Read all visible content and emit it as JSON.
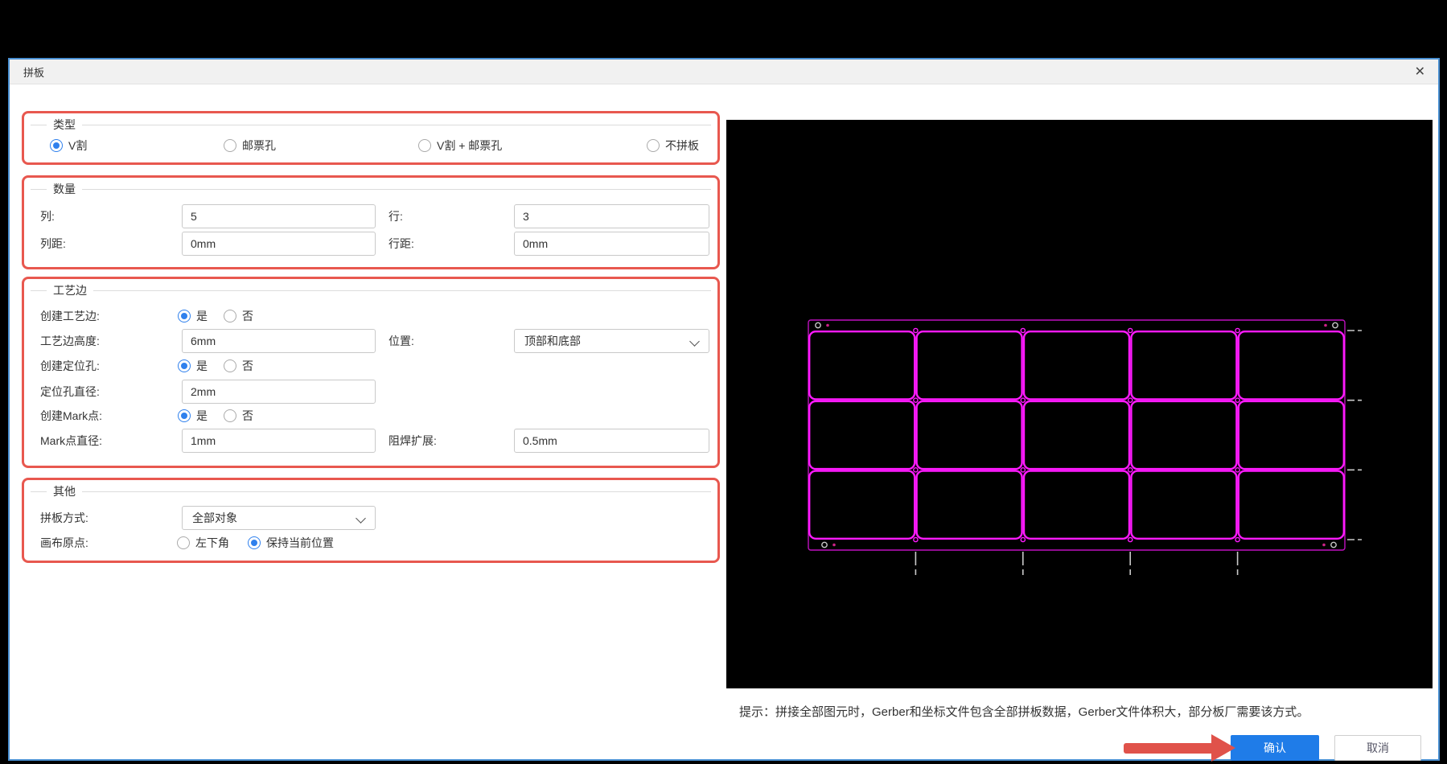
{
  "window": {
    "title": "拼板",
    "close_icon": "✕"
  },
  "colors": {
    "dialog_border": "#4a90d2",
    "highlight": "#e8584f",
    "radio_blue": "#2f80ed",
    "confirm_bg": "#1f7ce8",
    "arrow": "#e0524a",
    "board": "#ff1aff",
    "panel_outline": "#c011c0",
    "mark_dot": "#cc2288",
    "hole_ring": "#c8c8c8",
    "tick": "#c8c8c8"
  },
  "sections": {
    "type": {
      "legend": "类型",
      "options": [
        {
          "label": "V割",
          "selected": true
        },
        {
          "label": "邮票孔",
          "selected": false
        },
        {
          "label": "V割 + 邮票孔",
          "selected": false
        },
        {
          "label": "不拼板",
          "selected": false
        }
      ]
    },
    "quantity": {
      "legend": "数量",
      "col": {
        "label": "列:",
        "value": "5"
      },
      "row": {
        "label": "行:",
        "value": "3"
      },
      "col_gap": {
        "label": "列距:",
        "value": "0mm"
      },
      "row_gap": {
        "label": "行距:",
        "value": "0mm"
      }
    },
    "process_edge": {
      "legend": "工艺边",
      "create_edge": {
        "label": "创建工艺边:",
        "yes": "是",
        "no": "否",
        "yes_selected": true,
        "no_selected": false
      },
      "edge_height": {
        "label": "工艺边高度:",
        "value": "6mm"
      },
      "position": {
        "label": "位置:",
        "value": "顶部和底部"
      },
      "create_hole": {
        "label": "创建定位孔:",
        "yes": "是",
        "no": "否",
        "yes_selected": true,
        "no_selected": false
      },
      "hole_diameter": {
        "label": "定位孔直径:",
        "value": "2mm"
      },
      "create_mark": {
        "label": "创建Mark点:",
        "yes": "是",
        "no": "否",
        "yes_selected": true,
        "no_selected": false
      },
      "mark_diameter": {
        "label": "Mark点直径:",
        "value": "1mm"
      },
      "solder_expand": {
        "label": "阻焊扩展:",
        "value": "0.5mm"
      }
    },
    "other": {
      "legend": "其他",
      "panel_mode": {
        "label": "拼板方式:",
        "value": "全部对象"
      },
      "canvas_origin": {
        "label": "画布原点:",
        "options": [
          {
            "label": "左下角",
            "selected": false
          },
          {
            "label": "保持当前位置",
            "selected": true
          }
        ]
      }
    }
  },
  "preview": {
    "cols": 5,
    "rows": 3
  },
  "footer": {
    "hint": "提示：拼接全部图元时，Gerber和坐标文件包含全部拼板数据，Gerber文件体积大，部分板厂需要该方式。",
    "confirm_label": "确认",
    "cancel_label": "取消"
  }
}
